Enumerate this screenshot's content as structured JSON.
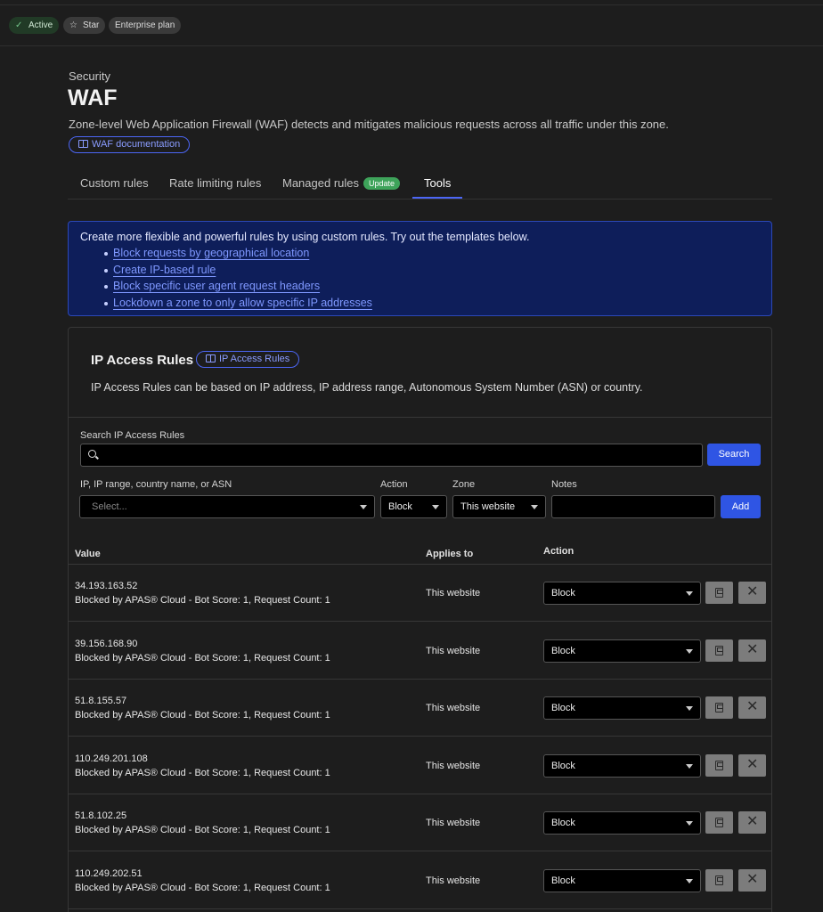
{
  "topbar": {
    "status_label": "Active",
    "star_label": "Star",
    "plan_label": "Enterprise plan"
  },
  "page": {
    "breadcrumb": "Security",
    "title": "WAF",
    "description": "Zone-level Web Application Firewall (WAF) detects and mitigates malicious requests across all traffic under this zone.",
    "doc_link": "WAF documentation"
  },
  "tabs": [
    {
      "label": "Custom rules"
    },
    {
      "label": "Rate limiting rules"
    },
    {
      "label": "Managed rules",
      "badge": "Update"
    },
    {
      "label": "Tools",
      "active": true
    }
  ],
  "banner": {
    "intro": "Create more flexible and powerful rules by using custom rules. Try out the templates below.",
    "links": [
      "Block requests by geographical location",
      "Create IP-based rule",
      "Block specific user agent request headers",
      "Lockdown a zone to only allow specific IP addresses"
    ]
  },
  "ip_access": {
    "title": "IP Access Rules",
    "doc_link": "IP Access Rules",
    "description": "IP Access Rules can be based on IP address, IP address range, Autonomous System Number (ASN) or country.",
    "search_label": "Search IP Access Rules",
    "search_value": "",
    "search_button": "Search",
    "form": {
      "value_label": "IP, IP range, country name, or ASN",
      "value_placeholder": "Select...",
      "action_label": "Action",
      "action_value": "Block",
      "zone_label": "Zone",
      "zone_value": "This website",
      "notes_label": "Notes",
      "notes_value": "",
      "add_button": "Add"
    },
    "columns": {
      "value": "Value",
      "applies_to": "Applies to",
      "action": "Action"
    },
    "rows": [
      {
        "ip": "34.193.163.52",
        "note": "Blocked by APAS® Cloud - Bot Score: 1, Request Count: 1",
        "applies": "This website",
        "action": "Block"
      },
      {
        "ip": "39.156.168.90",
        "note": "Blocked by APAS® Cloud - Bot Score: 1, Request Count: 1",
        "applies": "This website",
        "action": "Block"
      },
      {
        "ip": "51.8.155.57",
        "note": "Blocked by APAS® Cloud - Bot Score: 1, Request Count: 1",
        "applies": "This website",
        "action": "Block"
      },
      {
        "ip": "110.249.201.108",
        "note": "Blocked by APAS® Cloud - Bot Score: 1, Request Count: 1",
        "applies": "This website",
        "action": "Block"
      },
      {
        "ip": "51.8.102.25",
        "note": "Blocked by APAS® Cloud - Bot Score: 1, Request Count: 1",
        "applies": "This website",
        "action": "Block"
      },
      {
        "ip": "110.249.202.51",
        "note": "Blocked by APAS® Cloud - Bot Score: 1, Request Count: 1",
        "applies": "This website",
        "action": "Block"
      }
    ]
  },
  "icons": {
    "status": "check-icon",
    "star": "star-icon",
    "doc": "book-icon",
    "search": "search-icon",
    "save": "save-icon",
    "delete": "close-icon"
  },
  "colors": {
    "accent": "#2f55e4",
    "link": "#8a9cff",
    "active_green": "#3ea35a",
    "banner_bg": "#0e1e5a"
  }
}
